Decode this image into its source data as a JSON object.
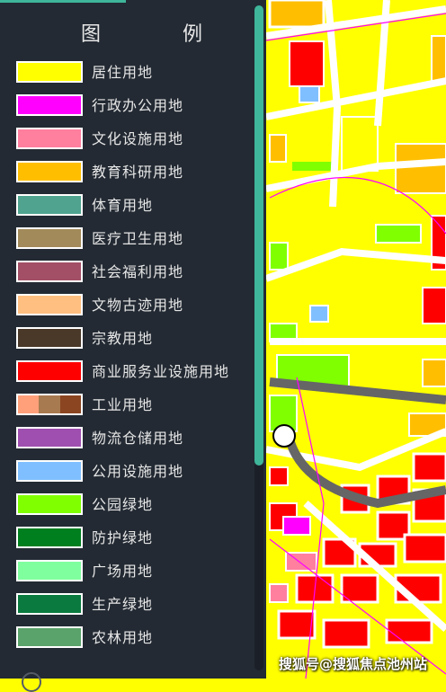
{
  "legend": {
    "title": "图 例",
    "items": [
      {
        "label": "居住用地",
        "color": "#ffff00"
      },
      {
        "label": "行政办公用地",
        "color": "#ff00ff"
      },
      {
        "label": "文化设施用地",
        "color": "#ff7f9f"
      },
      {
        "label": "教育科研用地",
        "color": "#ffbf00"
      },
      {
        "label": "体育用地",
        "color": "#4fa38f"
      },
      {
        "label": "医疗卫生用地",
        "color": "#a38a5a"
      },
      {
        "label": "社会福利用地",
        "color": "#a34f66"
      },
      {
        "label": "文物古迹用地",
        "color": "#ffbf80"
      },
      {
        "label": "宗教用地",
        "color": "#4a3828"
      },
      {
        "label": "商业服务业设施用地",
        "color": "#ff0000"
      },
      {
        "label": "工业用地",
        "colors": [
          "#ffa07a",
          "#a87a50",
          "#8b4520"
        ]
      },
      {
        "label": "物流仓储用地",
        "color": "#9f4faf"
      },
      {
        "label": "公用设施用地",
        "color": "#80bfff"
      },
      {
        "label": "公园绿地",
        "color": "#80ff00"
      },
      {
        "label": "防护绿地",
        "color": "#007f1f"
      },
      {
        "label": "广场用地",
        "color": "#80ff9f"
      },
      {
        "label": "生产绿地",
        "color": "#0a7a3e"
      },
      {
        "label": "农林用地",
        "color": "#5aa36a"
      }
    ]
  },
  "watermark": "搜狐号@搜狐焦点池州站",
  "colors": {
    "panel_bg": "#232a33",
    "accent": "#3fb59a",
    "road": "#ffffff",
    "railway": "#666666",
    "boundary": "#ff00ff"
  }
}
